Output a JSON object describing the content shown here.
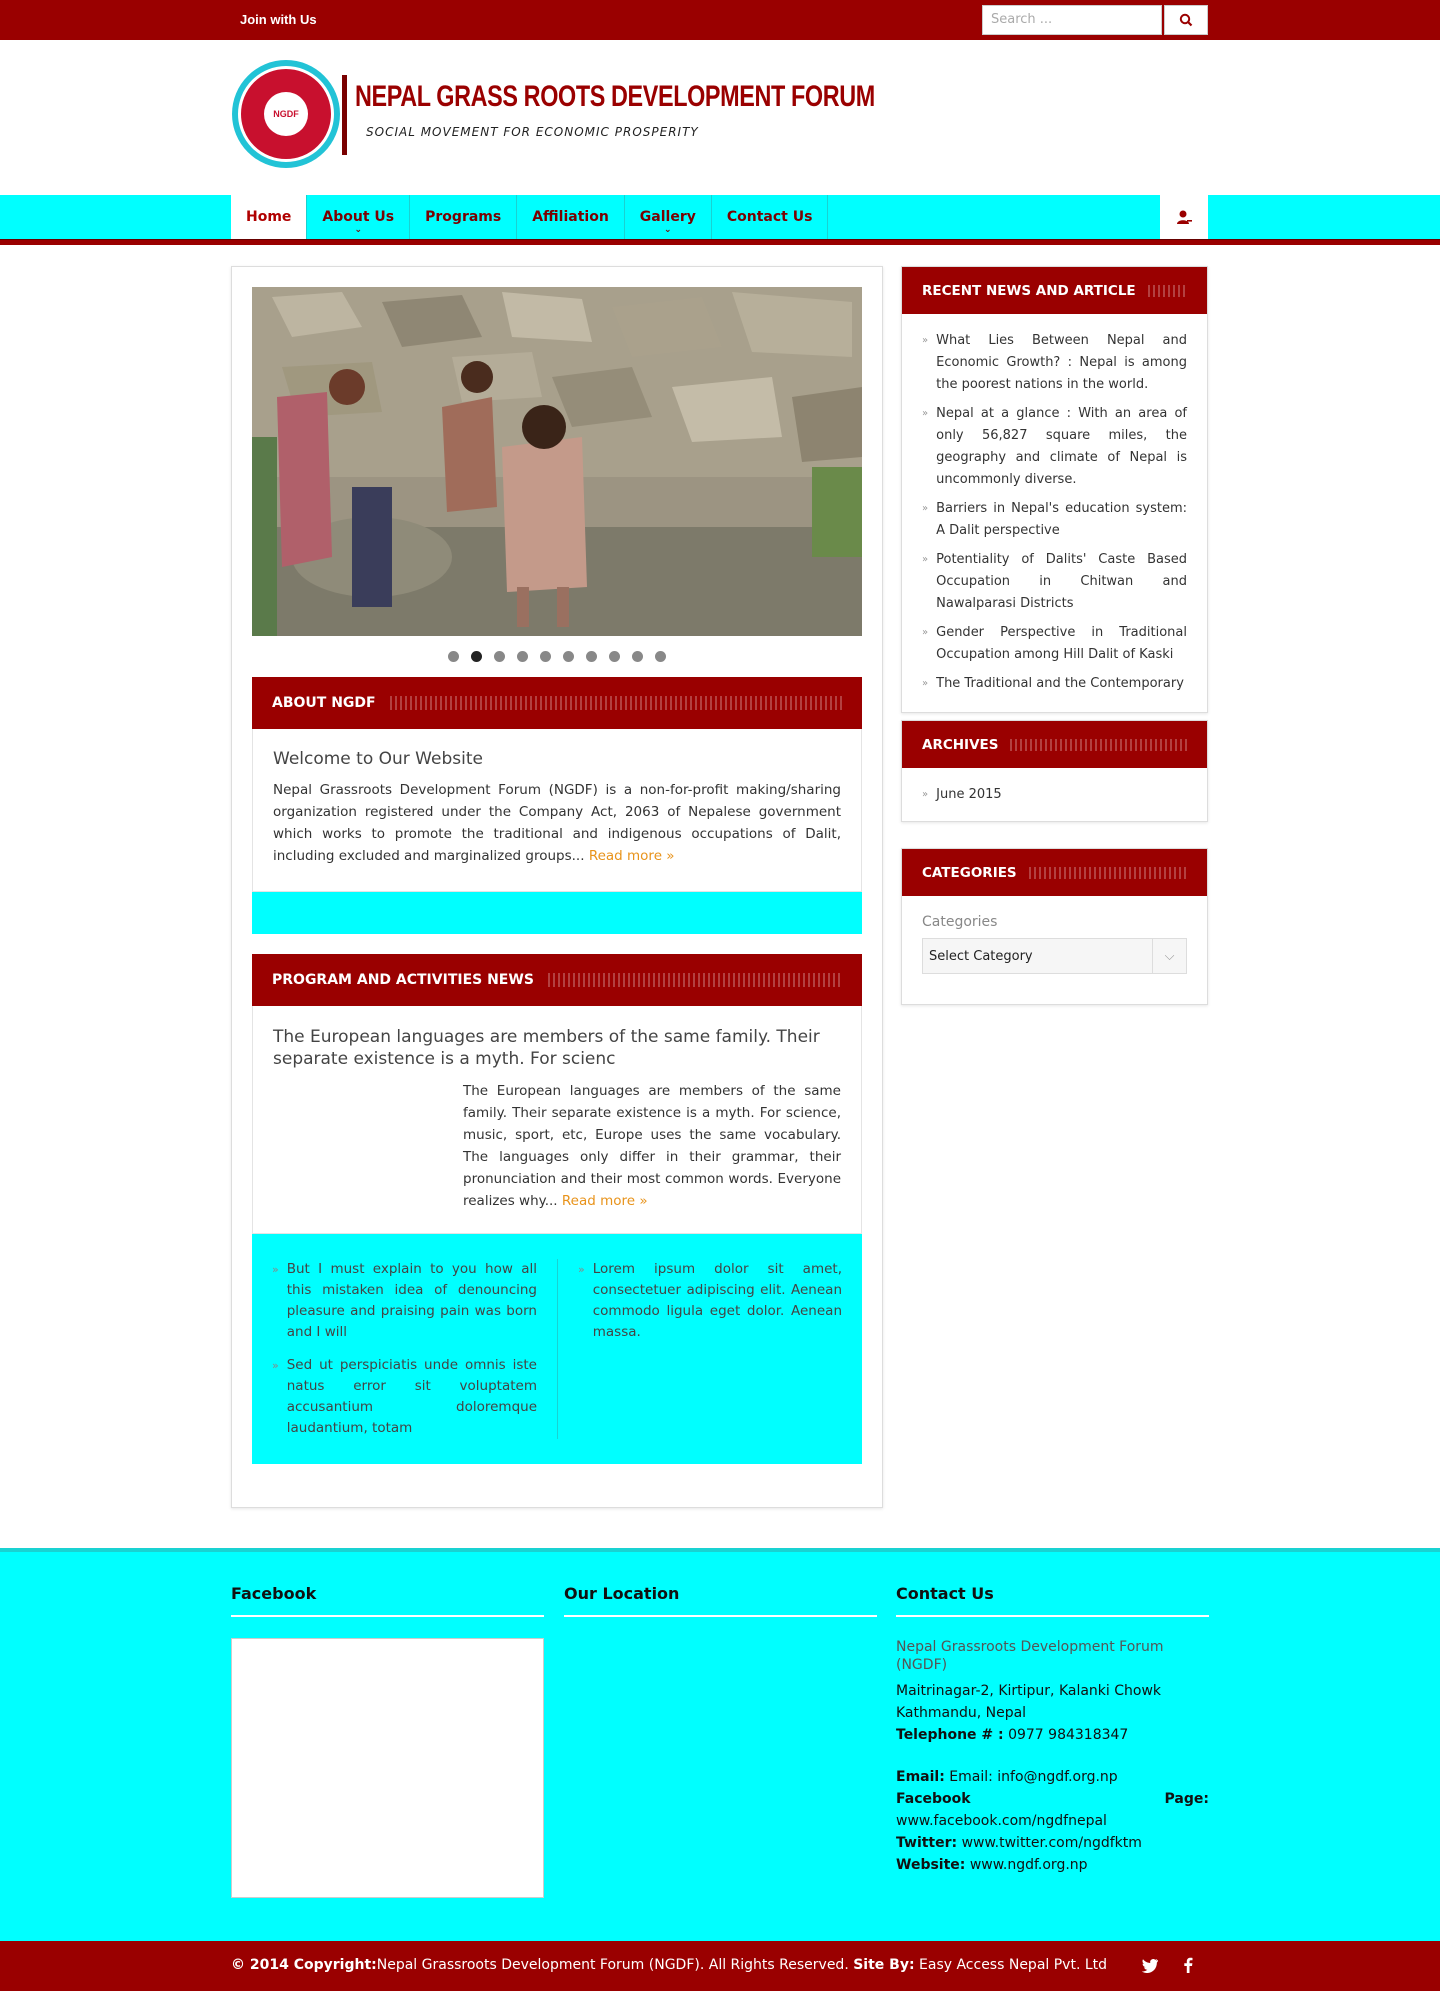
{
  "topbar": {
    "join": "Join with Us",
    "search_placeholder": "Search ..."
  },
  "header": {
    "title": "NEPAL GRASS ROOTS DEVELOPMENT FORUM",
    "tagline": "SOCIAL MOVEMENT FOR ECONOMIC PROSPERITY",
    "logo_text": "NGDF"
  },
  "nav": {
    "items": [
      {
        "label": "Home"
      },
      {
        "label": "About Us"
      },
      {
        "label": "Programs"
      },
      {
        "label": "Affiliation"
      },
      {
        "label": "Gallery"
      },
      {
        "label": "Contact Us"
      }
    ]
  },
  "slider": {
    "dots": 10,
    "active_dot": 2
  },
  "about": {
    "heading": "ABOUT NGDF",
    "title": "Welcome to Our Website",
    "text": "Nepal Grassroots Development Forum (NGDF) is a non-for-profit making/sharing organization registered under the Company Act, 2063 of Nepalese government which works to promote the traditional and indigenous occupations of Dalit, including excluded and marginalized groups...",
    "read_more": "Read more »"
  },
  "programs": {
    "heading": "PROGRAM AND ACTIVITIES NEWS",
    "title": "The European languages are members of the same family. Their separate existence is a myth. For scienc",
    "text": "The European languages are members of the same family. Their separate existence is a myth. For science, music, sport, etc, Europe uses the same vocabulary. The languages only differ in their grammar, their pronunciation and their most common words. Everyone realizes why...",
    "read_more": "Read more »",
    "list_left": [
      "But I must explain to you how all this mistaken idea of denouncing pleasure and praising pain was born and I will",
      "Sed ut perspiciatis unde omnis iste natus error sit voluptatem accusantium doloremque laudantium, totam"
    ],
    "list_right": [
      "Lorem ipsum dolor sit amet, consectetuer adipiscing elit. Aenean commodo ligula eget dolor. Aenean massa."
    ]
  },
  "sidebar": {
    "recent": {
      "heading": "RECENT NEWS AND ARTICLE",
      "items": [
        "What Lies Between Nepal and Economic Growth? : Nepal is among the poorest nations in the world.",
        "Nepal at a glance : With an area of only 56,827 square miles, the geography and climate of Nepal is uncommonly diverse.",
        "Barriers in Nepal's education system: A Dalit perspective",
        "Potentiality of Dalits' Caste Based Occupation in Chitwan and Nawalparasi Districts",
        "Gender Perspective in Traditional Occupation among Hill Dalit of Kaski",
        "The Traditional and the Contemporary"
      ]
    },
    "archives": {
      "heading": "ARCHIVES",
      "items": [
        "June 2015"
      ]
    },
    "categories": {
      "heading": "CATEGORIES",
      "label": "Categories",
      "selected": "Select Category"
    }
  },
  "footer": {
    "facebook_title": "Facebook",
    "location_title": "Our Location",
    "contact_title": "Contact Us",
    "contact": {
      "org": "Nepal Grassroots Development Forum (NGDF)",
      "address1": "Maitrinagar-2, Kirtipur, Kalanki Chowk",
      "address2": "Kathmandu, Nepal",
      "tel_label": "Telephone # :",
      "tel": "0977 984318347",
      "email_label": "Email:",
      "email": "Email: info@ngdf.org.np",
      "fb_label": "Facebook",
      "fb_page": "Page:",
      "fb_url": "www.facebook.com/ngdfnepal",
      "twitter_label": "Twitter:",
      "twitter": "www.twitter.com/ngdfktm",
      "website_label": "Website:",
      "website": "www.ngdf.org.np"
    }
  },
  "bottombar": {
    "copy_label": "© 2014 Copyright:",
    "copy_text": "Nepal Grassroots Development Forum (NGDF). All Rights Reserved.",
    "site_by_label": "Site By:",
    "site_by": "Easy Access Nepal Pvt. Ltd"
  },
  "colors": {
    "brand_red": "#9a0000",
    "cyan": "#00ffff",
    "link_orange": "#e8931b"
  },
  "icons": [
    "search-icon",
    "user-icon",
    "twitter-icon",
    "facebook-icon",
    "chevron-down-icon",
    "chevron-right-icon"
  ]
}
